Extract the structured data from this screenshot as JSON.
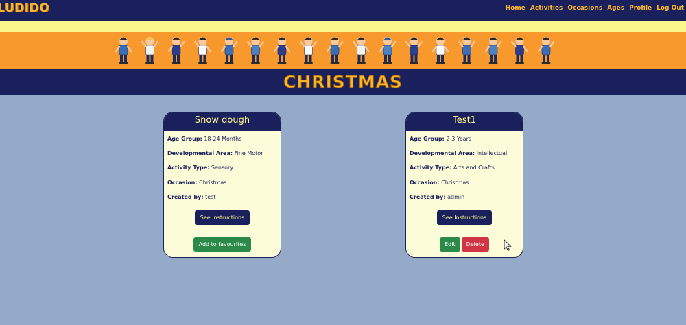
{
  "nav": {
    "brand": "LUDIDO",
    "links": [
      "Home",
      "Activities",
      "Occasions",
      "Ages",
      "Profile",
      "Log Out"
    ]
  },
  "page": {
    "title": "CHRISTMAS"
  },
  "cards": [
    {
      "title": "Snow dough",
      "fields": [
        {
          "label": "Age Group:",
          "value": "18-24 Months"
        },
        {
          "label": "Developmental Area:",
          "value": "Fine Motor"
        },
        {
          "label": "Activity Type:",
          "value": "Sensory"
        },
        {
          "label": "Occasion:",
          "value": "Christmas"
        },
        {
          "label": "Created by:",
          "value": "test"
        }
      ],
      "instructions_label": "See Instructions",
      "favourite_label": "Add to favourites"
    },
    {
      "title": "Test1",
      "fields": [
        {
          "label": "Age Group:",
          "value": "2-3 Years"
        },
        {
          "label": "Developmental Area:",
          "value": "Intellectual"
        },
        {
          "label": "Activity Type:",
          "value": "Arts and Crafts"
        },
        {
          "label": "Occasion:",
          "value": "Christmas"
        },
        {
          "label": "Created by:",
          "value": "admin"
        }
      ],
      "instructions_label": "See Instructions",
      "edit_label": "Edit",
      "delete_label": "Delete"
    }
  ],
  "colors": {
    "navy": "#19205c",
    "orange": "#f7992d",
    "light_yellow": "#fcf78a",
    "gold": "#fbb52a",
    "background": "#95a9c8",
    "card_bg": "#fdfcd9",
    "green": "#2b8a48",
    "red": "#d03545"
  }
}
